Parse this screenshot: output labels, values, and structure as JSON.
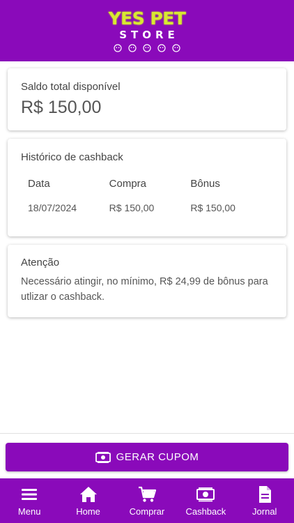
{
  "header": {
    "logo_top": "YES PET",
    "logo_bottom": "STORE"
  },
  "balance": {
    "label": "Saldo total disponível",
    "value": "R$ 150,00"
  },
  "history": {
    "title": "Histórico de cashback",
    "columns": [
      "Data",
      "Compra",
      "Bônus"
    ],
    "rows": [
      [
        "18/07/2024",
        "R$ 150,00",
        "R$ 150,00"
      ]
    ]
  },
  "notice": {
    "title": "Atenção",
    "text": "Necessário atingir, no mínimo, R$ 24,99 de bônus para utlizar o cashback."
  },
  "coupon_button": {
    "label": "GERAR CUPOM",
    "icon": "money-icon"
  },
  "bottom_nav": {
    "items": [
      {
        "label": "Menu",
        "icon": "menu-icon"
      },
      {
        "label": "Home",
        "icon": "home-icon"
      },
      {
        "label": "Comprar",
        "icon": "cart-icon"
      },
      {
        "label": "Cashback",
        "icon": "money-icon"
      },
      {
        "label": "Jornal",
        "icon": "document-icon"
      }
    ]
  },
  "colors": {
    "brand": "#8a0aba",
    "logo_accent": "#d8e832"
  }
}
